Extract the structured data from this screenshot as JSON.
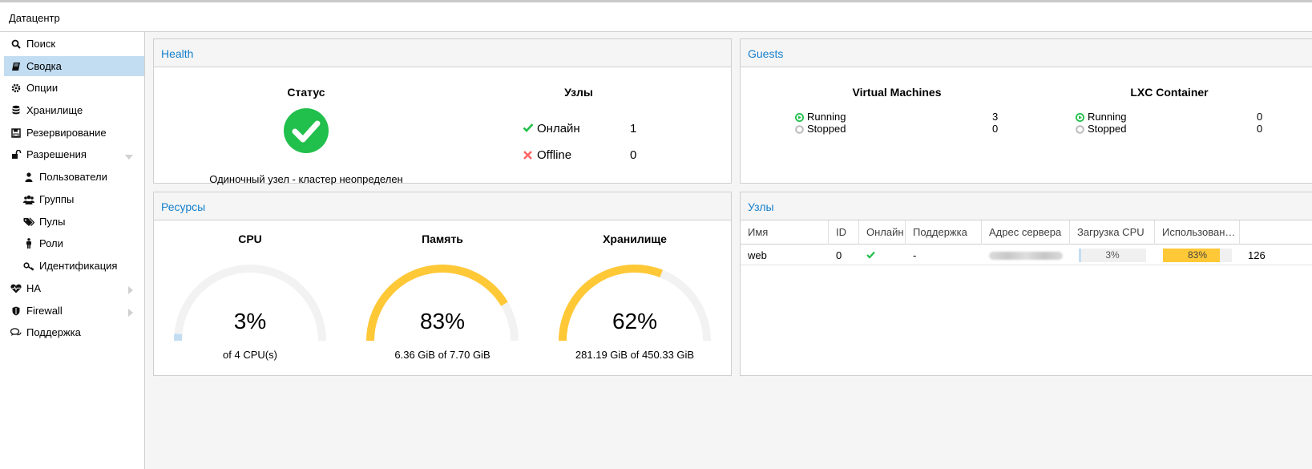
{
  "topbar": {
    "title": "Датацентр"
  },
  "sidebar": {
    "items": [
      {
        "label": "Поиск",
        "icon": "search-icon"
      },
      {
        "label": "Сводка",
        "icon": "book-icon",
        "selected": true
      },
      {
        "label": "Опции",
        "icon": "gear-icon"
      },
      {
        "label": "Хранилище",
        "icon": "database-icon"
      },
      {
        "label": "Резервирование",
        "icon": "floppy-icon"
      },
      {
        "label": "Разрешения",
        "icon": "unlock-icon"
      },
      {
        "label": "Пользователи",
        "icon": "user-icon"
      },
      {
        "label": "Группы",
        "icon": "users-icon"
      },
      {
        "label": "Пулы",
        "icon": "tags-icon"
      },
      {
        "label": "Роли",
        "icon": "male-icon"
      },
      {
        "label": "Идентификация",
        "icon": "key-icon"
      },
      {
        "label": "HA",
        "icon": "heartbeat-icon"
      },
      {
        "label": "Firewall",
        "icon": "shield-icon"
      },
      {
        "label": "Поддержка",
        "icon": "comments-icon"
      }
    ]
  },
  "health": {
    "title": "Health",
    "status_title": "Статус",
    "status_text": "Одиночный узел - кластер неопределен",
    "nodes_title": "Узлы",
    "online_label": "Онлайн",
    "online_count": "1",
    "offline_label": "Offline",
    "offline_count": "0"
  },
  "guests": {
    "title": "Guests",
    "vm_title": "Virtual Machines",
    "lxc_title": "LXC Container",
    "vm_running_label": "Running",
    "vm_running": "3",
    "vm_stopped_label": "Stopped",
    "vm_stopped": "0",
    "lxc_running_label": "Running",
    "lxc_running": "0",
    "lxc_stopped_label": "Stopped",
    "lxc_stopped": "0"
  },
  "resources": {
    "title": "Ресурсы",
    "cpu": {
      "title": "CPU",
      "value": "3%",
      "fraction": 0.03,
      "sub": "of 4 CPU(s)"
    },
    "memory": {
      "title": "Память",
      "value": "83%",
      "fraction": 0.83,
      "sub": "6.36 GiB of 7.70 GiB"
    },
    "storage": {
      "title": "Хранилище",
      "value": "62%",
      "fraction": 0.62,
      "sub": "281.19 GiB of 450.33 GiB"
    }
  },
  "nodes": {
    "title": "Узлы",
    "columns": [
      "Имя",
      "ID",
      "Онлайн",
      "Поддержка",
      "Адрес сервера",
      "Загрузка CPU",
      "Использование памяти"
    ],
    "row": {
      "name": "web",
      "id": "0",
      "support": "-",
      "cpu": "3%",
      "cpu_fraction": 0.03,
      "memory": "83%",
      "memory_fraction": 0.83,
      "extra": "126"
    }
  },
  "colors": {
    "accent": "#157fcc",
    "gauge": "#ffc837",
    "green": "#21bf4b",
    "red": "#ff6666",
    "bar_blue": "#c2ddf2"
  }
}
